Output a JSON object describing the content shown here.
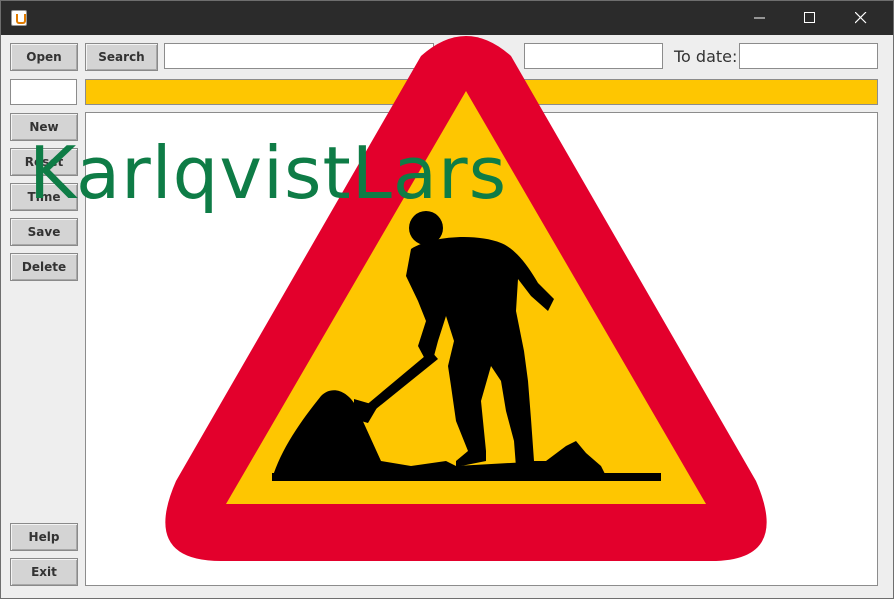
{
  "window": {
    "title": "",
    "controls": {
      "minimize_icon": "minimize-icon",
      "maximize_icon": "maximize-icon",
      "close_icon": "close-icon"
    }
  },
  "toolbar": {
    "open_label": "Open",
    "search_label": "Search",
    "search_value": "",
    "from_date_value": "",
    "to_date_label": "To date:",
    "to_date_value": ""
  },
  "id_field_value": "",
  "progress": {
    "value": 1.0,
    "color": "#fec601"
  },
  "sidebar": {
    "new_label": "New",
    "reset_label": "Reset",
    "time_label": "Time",
    "save_label": "Save",
    "delete_label": "Delete",
    "help_label": "Help",
    "exit_label": "Exit"
  },
  "overlay": {
    "watermark_text": "KarlqvistLars",
    "watermark_color": "#0e7c46",
    "sign_icon": "road-work-warning-sign-icon",
    "sign_colors": {
      "border": "#e3002c",
      "fill": "#fec601",
      "figure": "#000000"
    }
  }
}
